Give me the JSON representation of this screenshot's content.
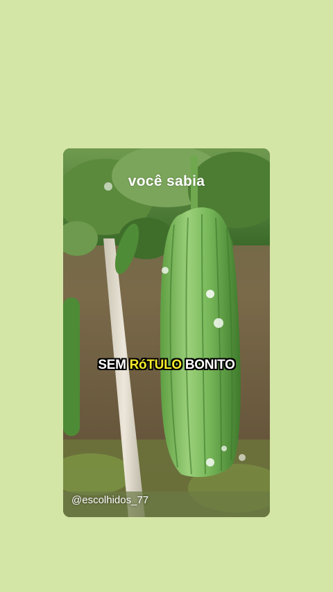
{
  "video": {
    "title_text": "você sabia",
    "caption": {
      "part1": "SEM",
      "part2": "RóTULO",
      "part3": "BONITO"
    },
    "handle": "@escolhidos_77",
    "subject": "luffa gourd hanging on vine"
  },
  "colors": {
    "page_background": "#d4e6a5",
    "caption_highlight": "#f5ea2a",
    "caption_text": "#ffffff",
    "caption_outline": "#000000"
  }
}
